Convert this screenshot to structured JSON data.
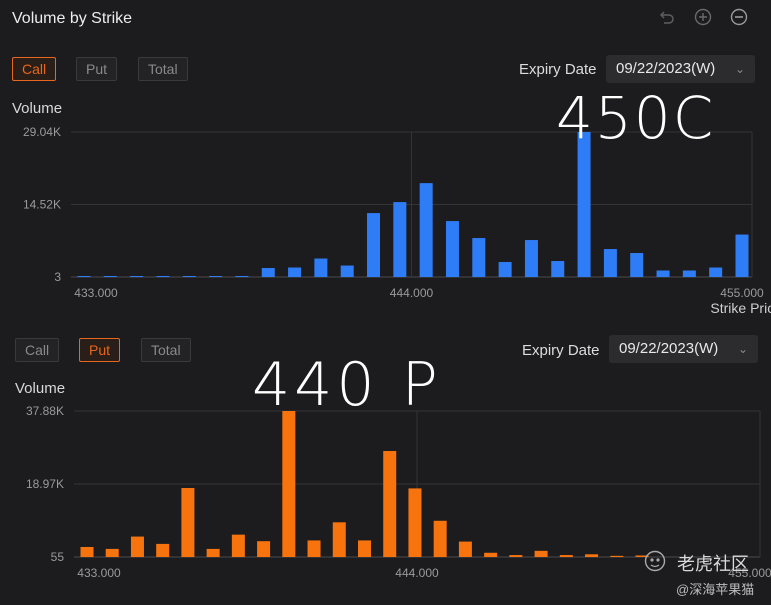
{
  "header": {
    "title": "Volume by Strike"
  },
  "toolbar_icons": [
    "undo-icon",
    "zoom-in-icon",
    "zoom-out-icon"
  ],
  "colors": {
    "call": "#2f7df6",
    "put": "#f7730e",
    "accent": "#e8661e",
    "bg": "#1c1c1e"
  },
  "top_panel": {
    "tabs": [
      {
        "label": "Call",
        "active": true
      },
      {
        "label": "Put",
        "active": false
      },
      {
        "label": "Total",
        "active": false
      }
    ],
    "expiry_label": "Expiry Date",
    "expiry_value": "09/22/2023(W)",
    "annotation": "450C"
  },
  "bottom_panel": {
    "tabs": [
      {
        "label": "Call",
        "active": false
      },
      {
        "label": "Put",
        "active": true
      },
      {
        "label": "Total",
        "active": false
      }
    ],
    "expiry_label": "Expiry Date",
    "expiry_value": "09/22/2023(W)",
    "annotation": "440 P"
  },
  "chart_data": [
    {
      "type": "bar",
      "ylabel": "Volume",
      "xlabel": "Strike Price",
      "yticks": [
        "29.04K",
        "14.52K",
        "3"
      ],
      "xticks": [
        "433.000",
        "444.000",
        "455.000"
      ],
      "ylim": [
        3,
        29040
      ],
      "x": [
        433,
        434,
        435,
        436,
        437,
        438,
        439,
        440,
        441,
        442,
        443,
        444,
        445,
        446,
        447,
        448,
        449,
        450,
        451,
        452,
        453,
        454,
        455
      ],
      "series": [
        {
          "values": [
            200,
            200,
            200,
            200,
            200,
            200,
            200,
            1800,
            1900,
            3700,
            2300,
            12800,
            15000,
            18800,
            11200,
            7800,
            3000,
            7400,
            3200,
            29040,
            5600,
            4800,
            1300,
            1300,
            1900,
            8500
          ]
        }
      ]
    },
    {
      "type": "bar",
      "ylabel": "Volume",
      "xticks": [
        "433.000",
        "444.000",
        "455.000"
      ],
      "yticks": [
        "37.88K",
        "18.97K",
        "55"
      ],
      "ylim": [
        55,
        37880
      ],
      "series": [
        {
          "values": [
            2600,
            2100,
            5300,
            3400,
            17900,
            2100,
            5800,
            4100,
            37880,
            4300,
            9000,
            4300,
            27500,
            17800,
            9400,
            4000,
            1100,
            500,
            1600,
            500,
            700,
            300,
            400
          ]
        }
      ]
    }
  ],
  "watermark": {
    "brand": "老虎社区",
    "handle": "@深海苹果猫"
  }
}
